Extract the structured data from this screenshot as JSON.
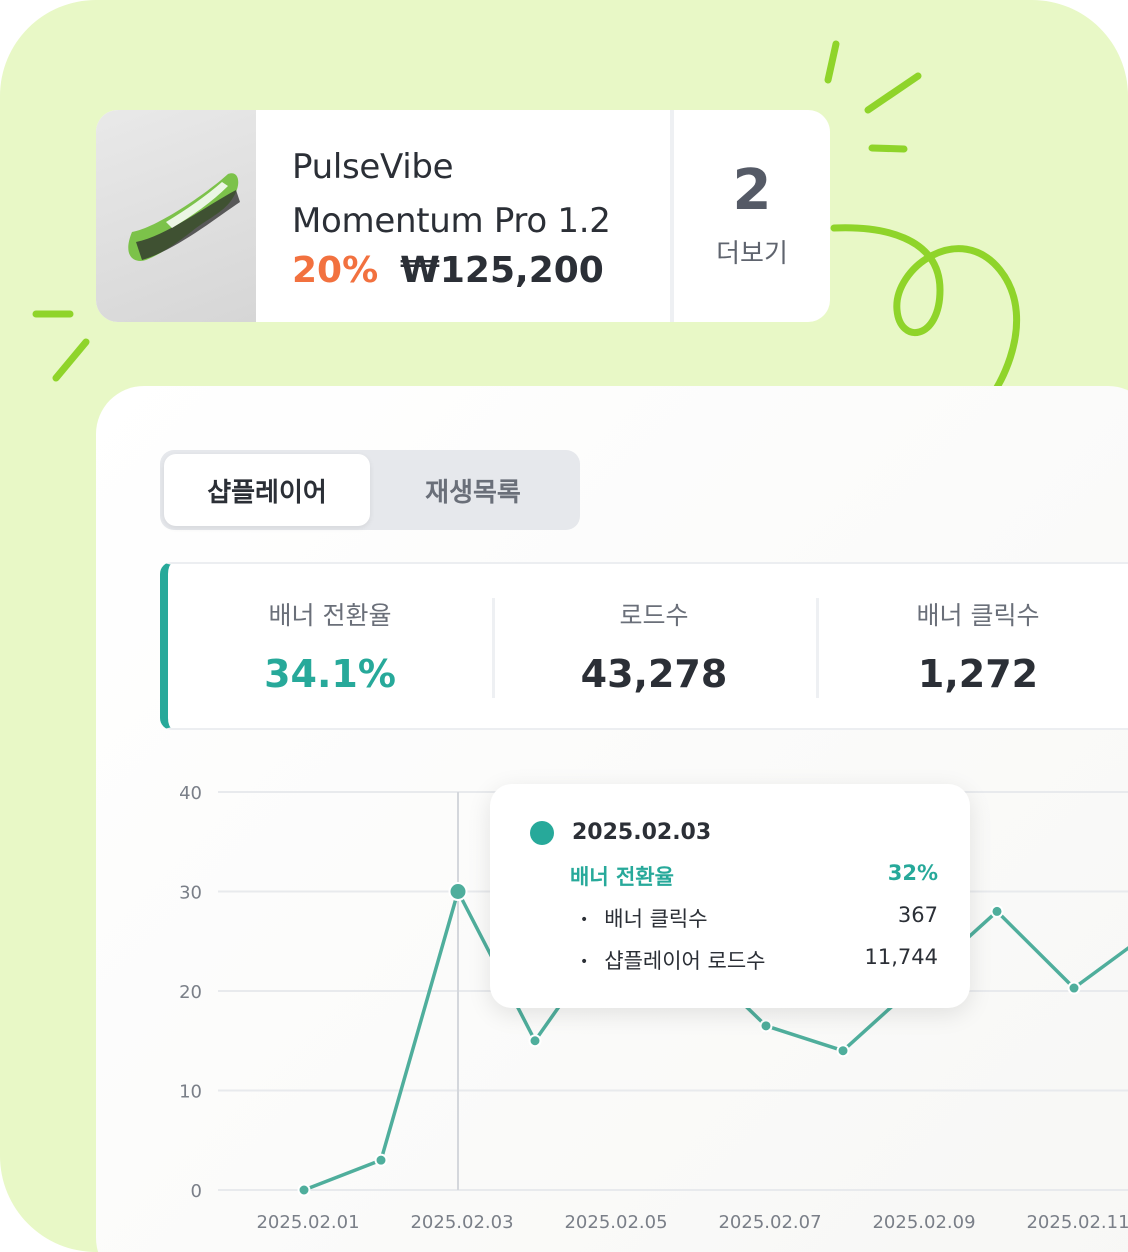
{
  "product": {
    "name_line1": "PulseVibe",
    "name_line2": "Momentum Pro 1.2",
    "discount": "20%",
    "price": "₩125,200",
    "more_count": "2",
    "more_label": "더보기",
    "image_icon": "sneaker-image"
  },
  "tabs": [
    {
      "label": "샵플레이어",
      "active": true
    },
    {
      "label": "재생목록",
      "active": false
    }
  ],
  "stats": [
    {
      "label": "배너 전환율",
      "value": "34.1%"
    },
    {
      "label": "로드수",
      "value": "43,278"
    },
    {
      "label": "배너 클릭수",
      "value": "1,272"
    }
  ],
  "tooltip": {
    "date": "2025.02.03",
    "main_label": "배너 전환율",
    "main_value": "32%",
    "rows": [
      {
        "label": "배너 클릭수",
        "value": "367"
      },
      {
        "label": "샵플레이어 로드수",
        "value": "11,744"
      }
    ]
  },
  "colors": {
    "background": "#e8f8c6",
    "accent": "#27a99a",
    "discount": "#f2713f",
    "doodle": "#8fd42a"
  },
  "chart_data": {
    "type": "line",
    "x": [
      "2025.02.01",
      "2025.02.02",
      "2025.02.03",
      "2025.02.04",
      "2025.02.05",
      "2025.02.06",
      "2025.02.07",
      "2025.02.08",
      "2025.02.09",
      "2025.02.10",
      "2025.02.11",
      "2025.02.12"
    ],
    "series": [
      {
        "values": [
          0,
          3,
          30,
          15,
          26,
          24,
          16.5,
          14,
          21,
          28,
          20.3,
          26
        ]
      }
    ],
    "xticks": [
      "2025.02.01",
      "2025.02.03",
      "2025.02.05",
      "2025.02.07",
      "2025.02.09",
      "2025.02.11"
    ],
    "yticks": [
      "0",
      "10",
      "20",
      "30",
      "40"
    ],
    "ylim": [
      0,
      40
    ],
    "grid": true,
    "highlight": "2025.02.03"
  }
}
